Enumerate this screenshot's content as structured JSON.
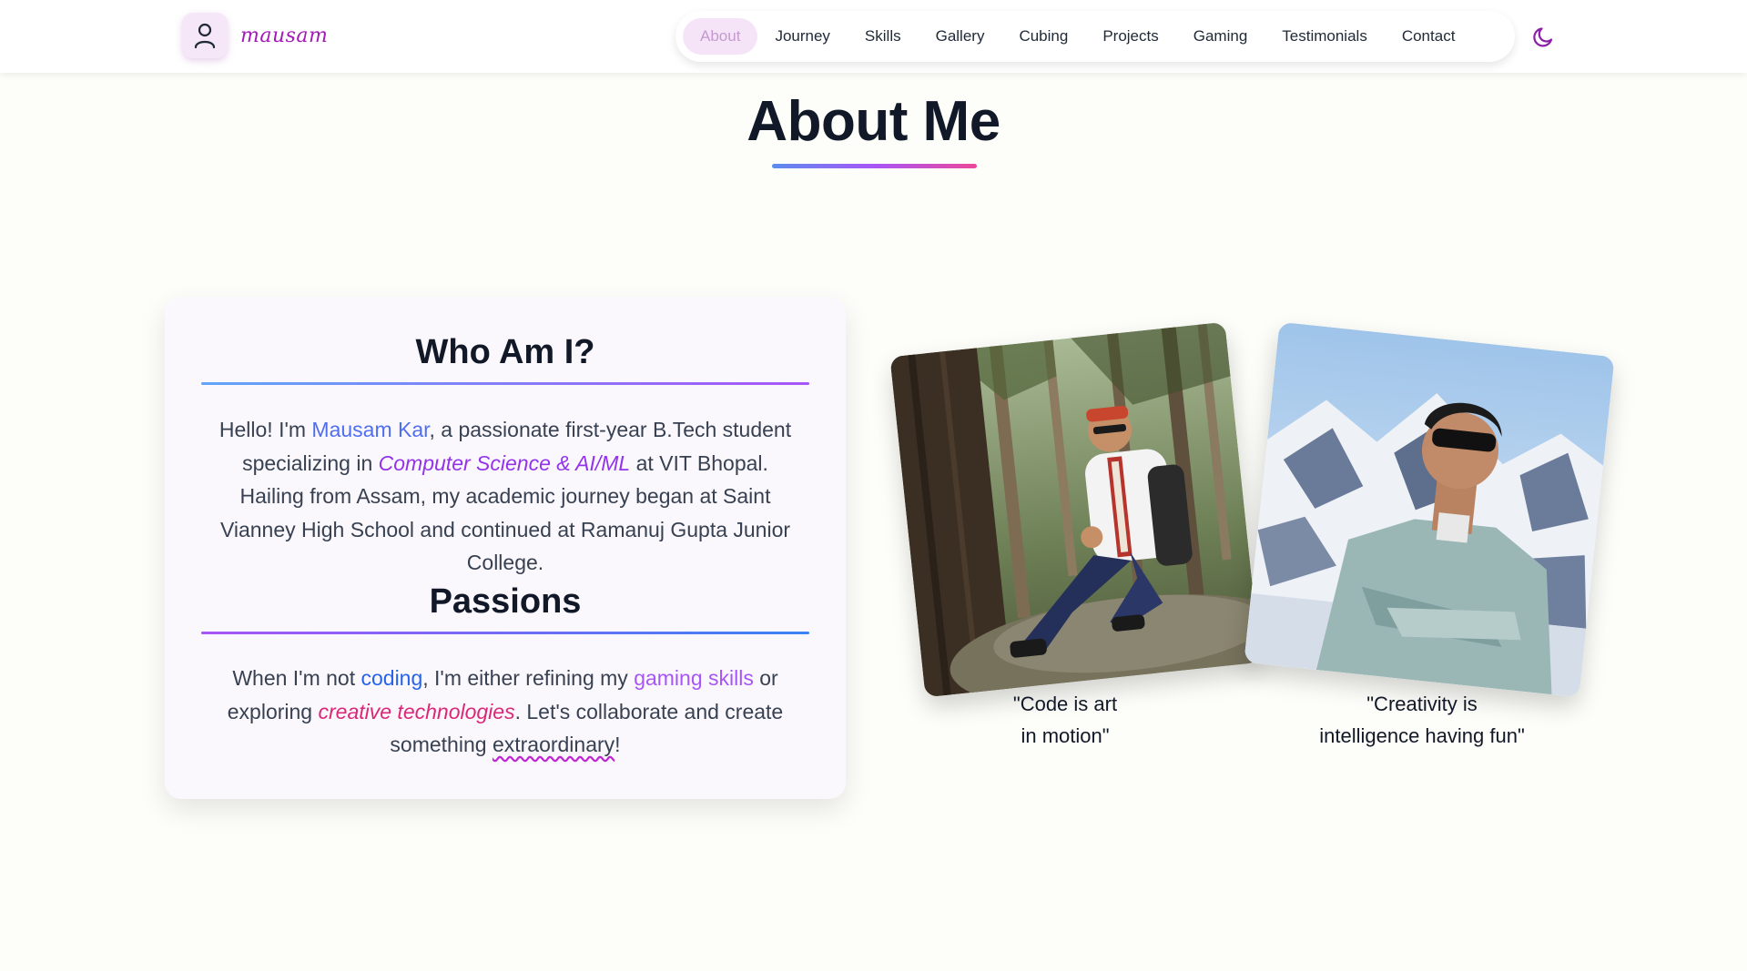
{
  "brand": {
    "name": "mausam",
    "logo_icon": "user-icon"
  },
  "nav": {
    "items": [
      "About",
      "Journey",
      "Skills",
      "Gallery",
      "Cubing",
      "Projects",
      "Gaming",
      "Testimonials",
      "Contact"
    ],
    "active": "About",
    "theme_icon": "moon-icon"
  },
  "section": {
    "title": "About Me"
  },
  "card": {
    "who_heading": "Who Am I?",
    "who": {
      "p1": "Hello! I'm ",
      "name": "Mausam Kar",
      "p2": ", a passionate first-year B.Tech student specializing in ",
      "field": "Computer Science & AI/ML",
      "p3": " at VIT Bhopal. Hailing from Assam, my academic journey began at Saint Vianney High School and continued at Ramanuj Gupta Junior College."
    },
    "passions_heading": "Passions",
    "passions": {
      "p1": "When I'm not ",
      "coding": "coding",
      "p2": ", I'm either refining my ",
      "gaming": "gaming skills",
      "p3": " or exploring ",
      "creative": "creative technologies",
      "p4": ". Let's collaborate and create something ",
      "extra": "extraordinary",
      "p5": "!"
    }
  },
  "photos": [
    {
      "caption_line1": "\"Code is art",
      "caption_line2": "in motion\""
    },
    {
      "caption_line1": "\"Creativity is",
      "caption_line2": "intelligence having fun\""
    }
  ],
  "colors": {
    "accent_purple": "#a31ab8",
    "link_blue": "#4f6ef0",
    "pink": "#db2777",
    "nav_active_bg": "#f5e4f8"
  }
}
